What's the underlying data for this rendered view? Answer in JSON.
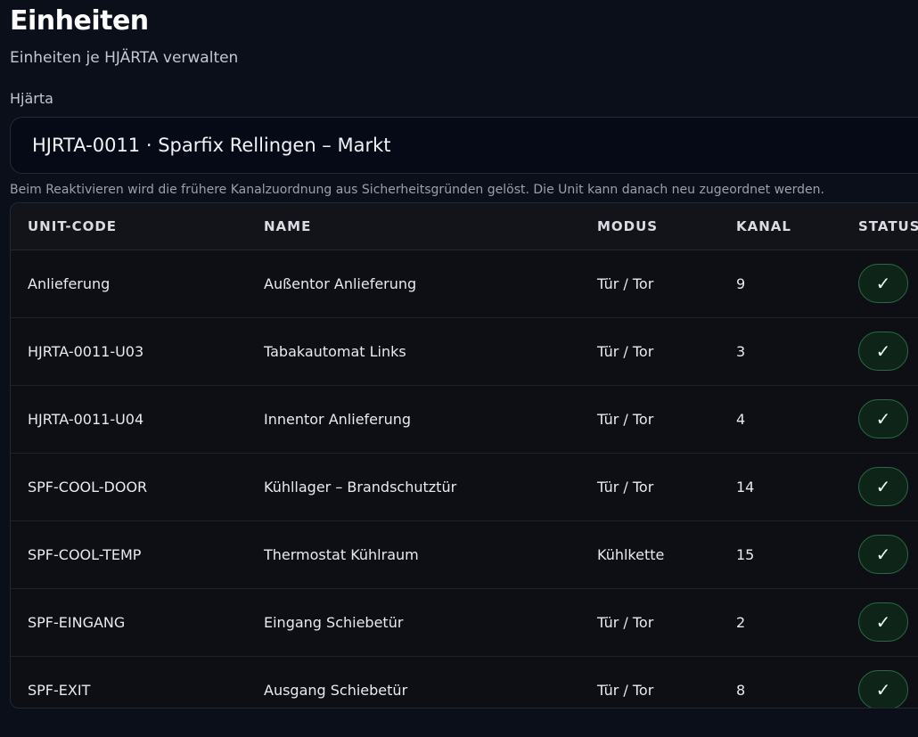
{
  "header": {
    "title": "Einheiten",
    "subtitle": "Einheiten je HJÄRTA verwalten"
  },
  "hjarta_select": {
    "label": "Hjärta",
    "value": "HJRTA-0011 · Sparfix Rellingen – Markt"
  },
  "hint": "Beim Reaktivieren wird die frühere Kanalzuordnung aus Sicherheitsgründen gelöst. Die Unit kann danach neu zugeordnet werden.",
  "table": {
    "columns": [
      "UNIT-CODE",
      "NAME",
      "MODUS",
      "KANAL",
      "STATUS"
    ],
    "rows": [
      {
        "code": "Anlieferung",
        "name": "Außentor Anlieferung",
        "mode": "Tür / Tor",
        "channel": "9",
        "status": "✓"
      },
      {
        "code": "HJRTA-0011-U03",
        "name": "Tabakautomat Links",
        "mode": "Tür / Tor",
        "channel": "3",
        "status": "✓"
      },
      {
        "code": "HJRTA-0011-U04",
        "name": "Innentor Anlieferung",
        "mode": "Tür / Tor",
        "channel": "4",
        "status": "✓"
      },
      {
        "code": "SPF-COOL-DOOR",
        "name": "Kühllager – Brandschutztür",
        "mode": "Tür / Tor",
        "channel": "14",
        "status": "✓"
      },
      {
        "code": "SPF-COOL-TEMP",
        "name": "Thermostat Kühlraum",
        "mode": "Kühlkette",
        "channel": "15",
        "status": "✓"
      },
      {
        "code": "SPF-EINGANG",
        "name": "Eingang Schiebetür",
        "mode": "Tür / Tor",
        "channel": "2",
        "status": "✓"
      },
      {
        "code": "SPF-EXIT",
        "name": "Ausgang Schiebetür",
        "mode": "Tür / Tor",
        "channel": "8",
        "status": "✓"
      }
    ]
  },
  "colors": {
    "background": "#0b0f19",
    "status_active_bg": "#0f2418",
    "status_active_border": "#2a6a43"
  }
}
